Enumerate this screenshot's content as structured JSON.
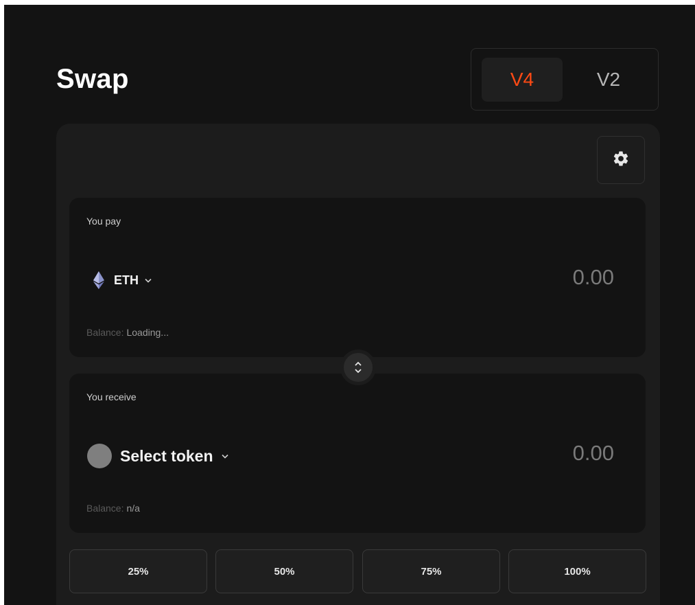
{
  "header": {
    "title": "Swap",
    "versions": [
      {
        "label": "V4",
        "active": true
      },
      {
        "label": "V2",
        "active": false
      }
    ]
  },
  "settings": {
    "icon": "gear-icon"
  },
  "pay": {
    "label": "You pay",
    "token": "ETH",
    "token_icon": "ethereum-icon",
    "amount": "0.00",
    "balance_label": "Balance:",
    "balance_value": "Loading..."
  },
  "flip": {
    "icon": "swap-arrows-icon"
  },
  "receive": {
    "label": "You receive",
    "token": "Select token",
    "amount": "0.00",
    "balance_label": "Balance:",
    "balance_value": "n/a"
  },
  "percent_buttons": [
    "25%",
    "50%",
    "75%",
    "100%"
  ],
  "colors": {
    "background": "#131313",
    "card": "#1c1c1c",
    "accent": "#ff4a14"
  }
}
